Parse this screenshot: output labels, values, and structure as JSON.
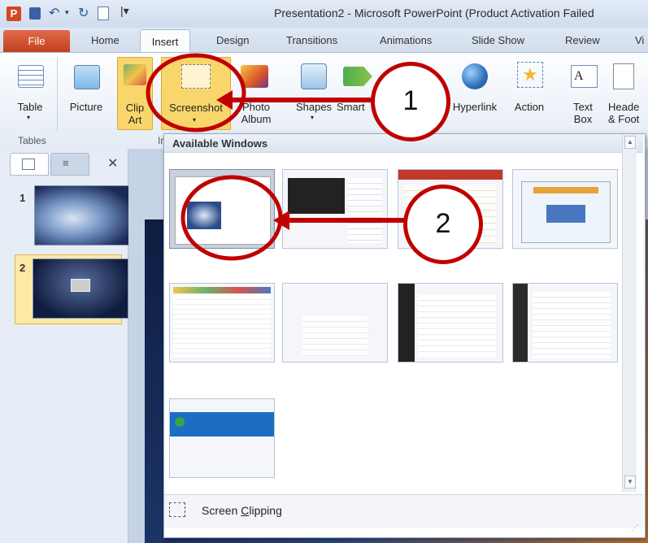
{
  "window": {
    "title": "Presentation2 - Microsoft PowerPoint (Product Activation Failed"
  },
  "tabs": [
    {
      "label": "File"
    },
    {
      "label": "Home"
    },
    {
      "label": "Insert"
    },
    {
      "label": "Design"
    },
    {
      "label": "Transitions"
    },
    {
      "label": "Animations"
    },
    {
      "label": "Slide Show"
    },
    {
      "label": "Review"
    },
    {
      "label": "Vi"
    }
  ],
  "ribbon": {
    "table": "Table",
    "picture": "Picture",
    "clip_art_1": "Clip",
    "clip_art_2": "Art",
    "screenshot": "Screenshot",
    "photo_album_1": "Photo",
    "photo_album_2": "Album",
    "shapes": "Shapes",
    "smart": "Smart",
    "hyperlink": "Hyperlink",
    "action": "Action",
    "text_box_1": "Text",
    "text_box_2": "Box",
    "header_1": "Heade",
    "header_2": "& Foot",
    "group_tables": "Tables",
    "group_images": "Ir"
  },
  "dropdown": {
    "title": "Available Windows",
    "screen_clipping_pre": "Screen ",
    "screen_clipping_underline": "C",
    "screen_clipping_post": "lipping"
  },
  "slides": [
    {
      "number": "1"
    },
    {
      "number": "2"
    }
  ],
  "annotations": [
    {
      "label": "1"
    },
    {
      "label": "2"
    }
  ],
  "colors": {
    "accent_red": "#c00000",
    "file_tab": "#c2401f",
    "highlight": "#f9d66b"
  }
}
